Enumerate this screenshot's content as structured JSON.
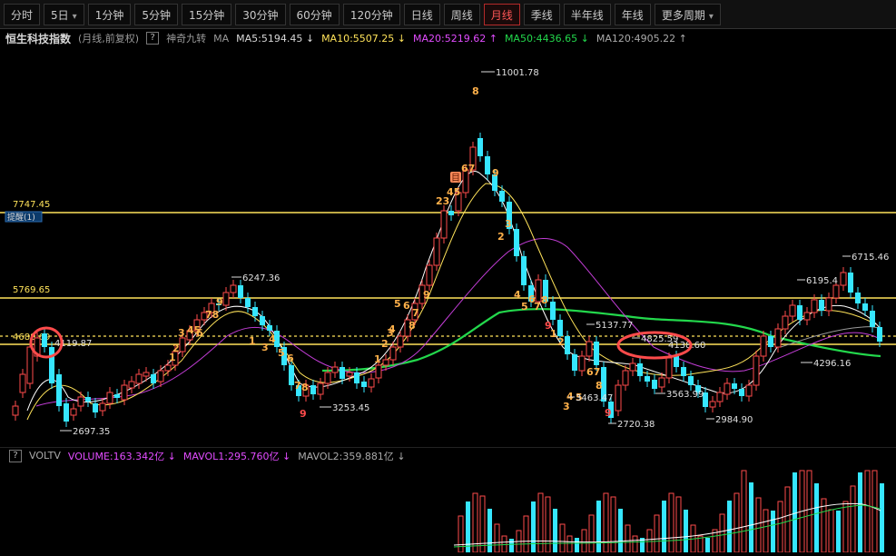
{
  "toolbar": {
    "tabs": [
      {
        "label": "分时"
      },
      {
        "label": "5日",
        "dropdown": true
      },
      {
        "label": "1分钟"
      },
      {
        "label": "5分钟"
      },
      {
        "label": "15分钟"
      },
      {
        "label": "30分钟"
      },
      {
        "label": "60分钟"
      },
      {
        "label": "120分钟"
      },
      {
        "label": "日线"
      },
      {
        "label": "周线"
      },
      {
        "label": "月线",
        "active": true
      },
      {
        "label": "季线"
      },
      {
        "label": "半年线"
      },
      {
        "label": "年线"
      },
      {
        "label": "更多周期",
        "dropdown": true
      }
    ]
  },
  "info": {
    "title": "恒生科技指数",
    "subtitle": "(月线,前复权)",
    "help": "?",
    "indicator": "神奇九转",
    "ma_label": "MA",
    "ma5": "MA5:5194.45",
    "ma10": "MA10:5507.25",
    "ma20": "MA20:5219.62",
    "ma50": "MA50:4436.65",
    "ma120": "MA120:4905.22",
    "arrows": {
      "ma5": "↓",
      "ma10": "↓",
      "ma20": "↑",
      "ma50": "↓",
      "ma120": "↑"
    }
  },
  "vol": {
    "label": "VOLTV",
    "volume": "VOLUME:163.342亿",
    "mavol1": "MAVOL1:295.760亿",
    "mavol2": "MAVOL2:359.881亿",
    "arrows": {
      "volume": "↓",
      "mavol1": "↓",
      "mavol2": "↓"
    }
  },
  "chart_annotations": {
    "h_lines": [
      {
        "label": "7747.45",
        "tag": "提醒(1)"
      },
      {
        "label": "5769.65"
      },
      {
        "label": "4688.69"
      }
    ],
    "price_labels": {
      "high": "11001.78",
      "p6247": "6247.36",
      "p6195": "6195.4",
      "p6715": "6715.46",
      "p5137": "5137.77",
      "p4825": "4825.59",
      "p4296": "4296.16",
      "p3563": "3563.99",
      "p2984": "2984.90",
      "p2720": "2720.38",
      "p3463": "3463.47",
      "p3253": "3253.45",
      "p2697": "2697.35",
      "p4119": "4119.87",
      "p4138": "4138.60"
    },
    "marker_icon": "目"
  },
  "colors": {
    "up": "#ff4b4b",
    "down": "#36e6ff",
    "ma5": "#ffffff",
    "ma10": "#ffe35a",
    "ma20": "#e24cff",
    "ma50": "#23d84c",
    "ma120": "#aaaaaa",
    "hline": "#ffe35a",
    "nine_seq": "#ffb14a",
    "highlight_circle": "#ff4b4b"
  }
}
